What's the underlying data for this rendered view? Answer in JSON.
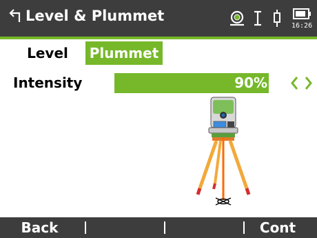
{
  "titlebar": {
    "title": "Level & Plummet",
    "back_icon": "back-arrow-icon",
    "status_icons": [
      "target-reflector-icon",
      "prism-constant-icon",
      "bluetooth-device-icon",
      "battery-icon"
    ],
    "time": "16:26"
  },
  "tabs": [
    {
      "label": "Level",
      "active": false
    },
    {
      "label": "Plummet",
      "active": true
    }
  ],
  "intensity": {
    "label": "Intensity",
    "value_text": "90%",
    "value_fraction": 0.9
  },
  "softkeys": [
    "Back",
    "",
    "",
    "Cont"
  ],
  "colors": {
    "accent": "#76b82a",
    "titlebar": "#3d3d3d",
    "laser": "#ff6a00",
    "tripod_leg": "#f2a93b",
    "tripod_tip": "#d32f2f"
  }
}
